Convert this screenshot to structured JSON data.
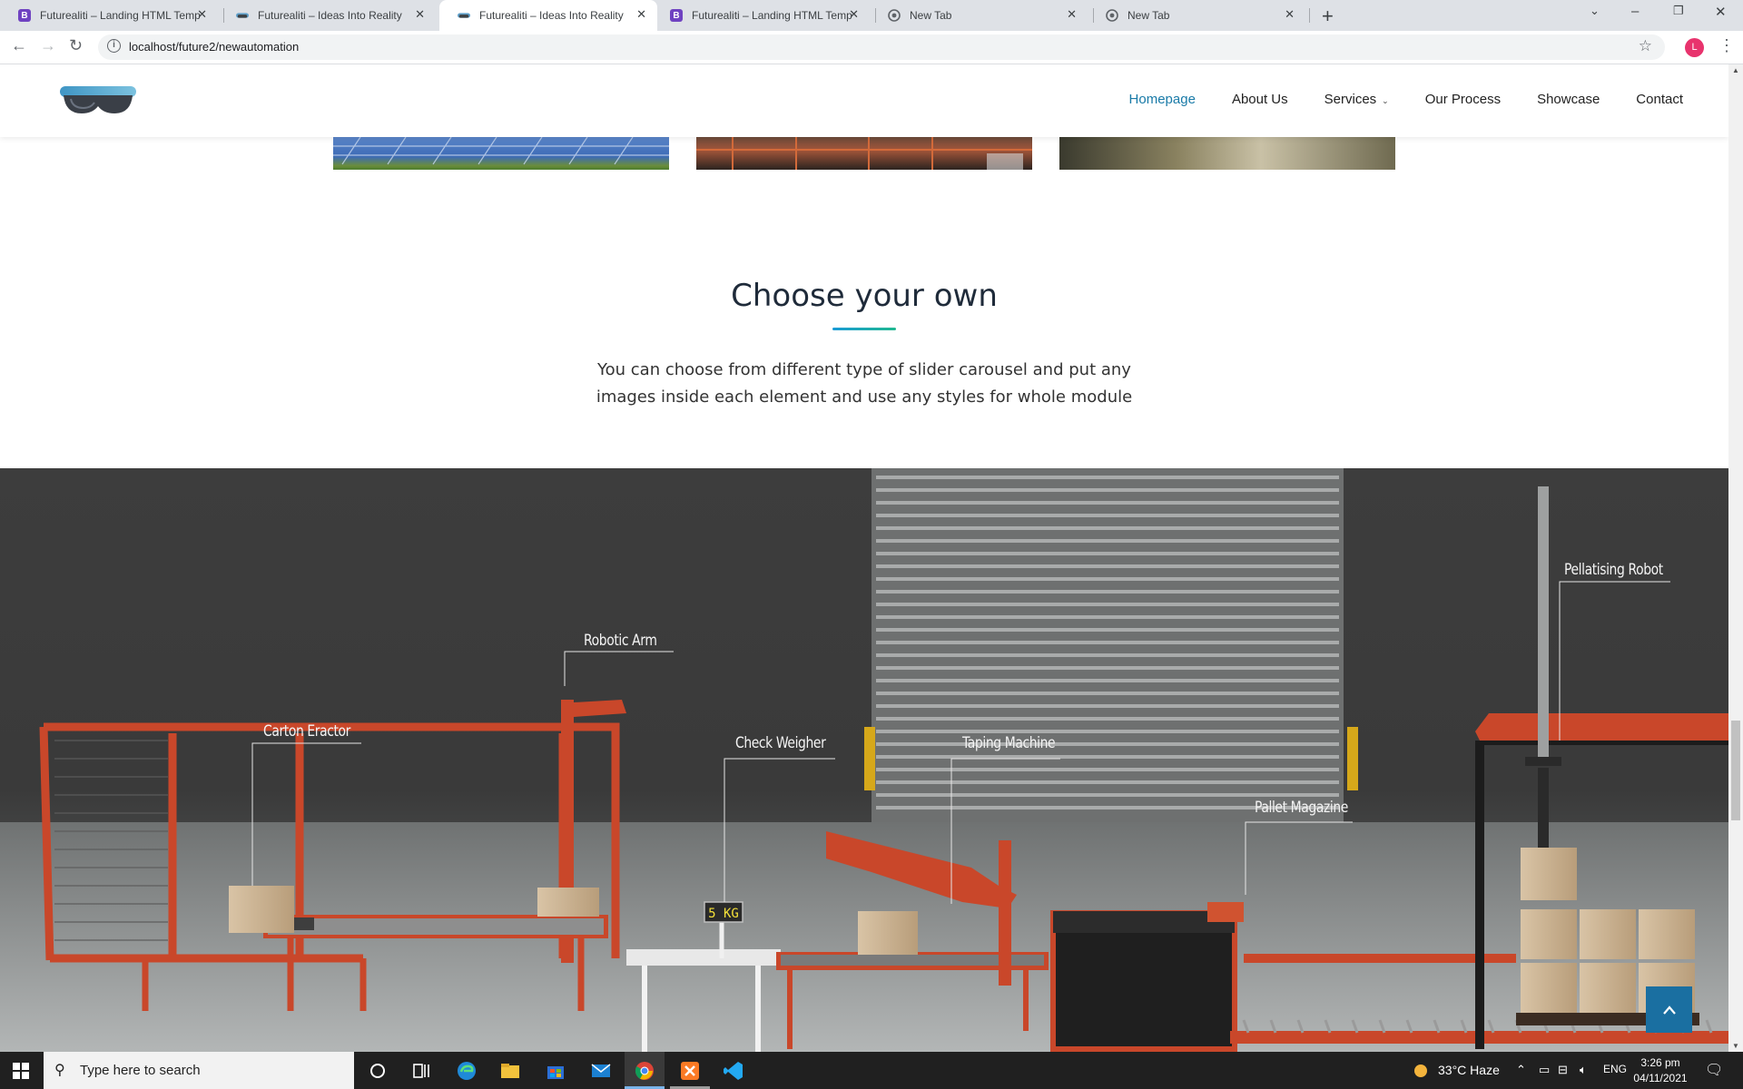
{
  "browser": {
    "tabs": [
      {
        "title": "Futurealiti – Landing HTML Temp",
        "favicon": "bootstrap-b",
        "active": false
      },
      {
        "title": "Futurealiti – Ideas Into Reality",
        "favicon": "vr-goggles",
        "active": false
      },
      {
        "title": "Futurealiti – Ideas Into Reality",
        "favicon": "vr-goggles",
        "active": true
      },
      {
        "title": "Futurealiti – Landing HTML Temp",
        "favicon": "bootstrap-b",
        "active": false
      },
      {
        "title": "New Tab",
        "favicon": "chrome",
        "active": false
      },
      {
        "title": "New Tab",
        "favicon": "chrome",
        "active": false
      }
    ],
    "url": "localhost/future2/newautomation",
    "profile_initial": "L"
  },
  "site": {
    "nav": [
      {
        "label": "Homepage",
        "active": true
      },
      {
        "label": "About Us",
        "active": false
      },
      {
        "label": "Services",
        "active": false,
        "has_dropdown": true
      },
      {
        "label": "Our Process",
        "active": false
      },
      {
        "label": "Showcase",
        "active": false
      },
      {
        "label": "Contact",
        "active": false
      }
    ],
    "accent_color": "#1a7ba8",
    "section": {
      "title": "Choose your own",
      "description": "You can choose from different type of slider carousel and put any images inside each element  and use any styles for whole module"
    },
    "callouts": {
      "carton_eractor": "Carton Eractor",
      "robotic_arm": "Robotic Arm",
      "check_weigher": "Check Weigher",
      "taping_machine": "Taping Machine",
      "pallet_magazine": "Pallet Magazine",
      "pellatising_robot": "Pellatising Robot"
    },
    "scale_display": "5 KG"
  },
  "taskbar": {
    "search_placeholder": "Type here to search",
    "weather": "33°C  Haze",
    "language": "ENG",
    "time": "3:26 pm",
    "date": "04/11/2021"
  }
}
